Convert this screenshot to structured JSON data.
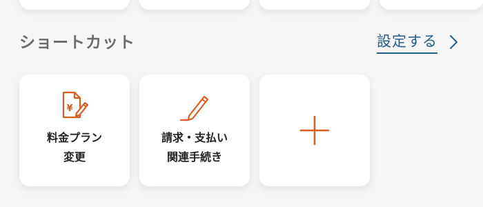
{
  "section": {
    "title": "ショートカット",
    "settings_link": "設定する"
  },
  "shortcuts": [
    {
      "line1": "料金プラン",
      "line2": "変更",
      "icon": "document-yen-pencil-icon"
    },
    {
      "line1": "請求・支払い",
      "line2": "関連手続き",
      "icon": "pencil-icon"
    },
    {
      "icon": "plus-icon"
    }
  ],
  "colors": {
    "accent": "#e05a1c",
    "link": "#1e5c8a",
    "title": "#6b6b6b",
    "background": "#f6f6f6"
  }
}
